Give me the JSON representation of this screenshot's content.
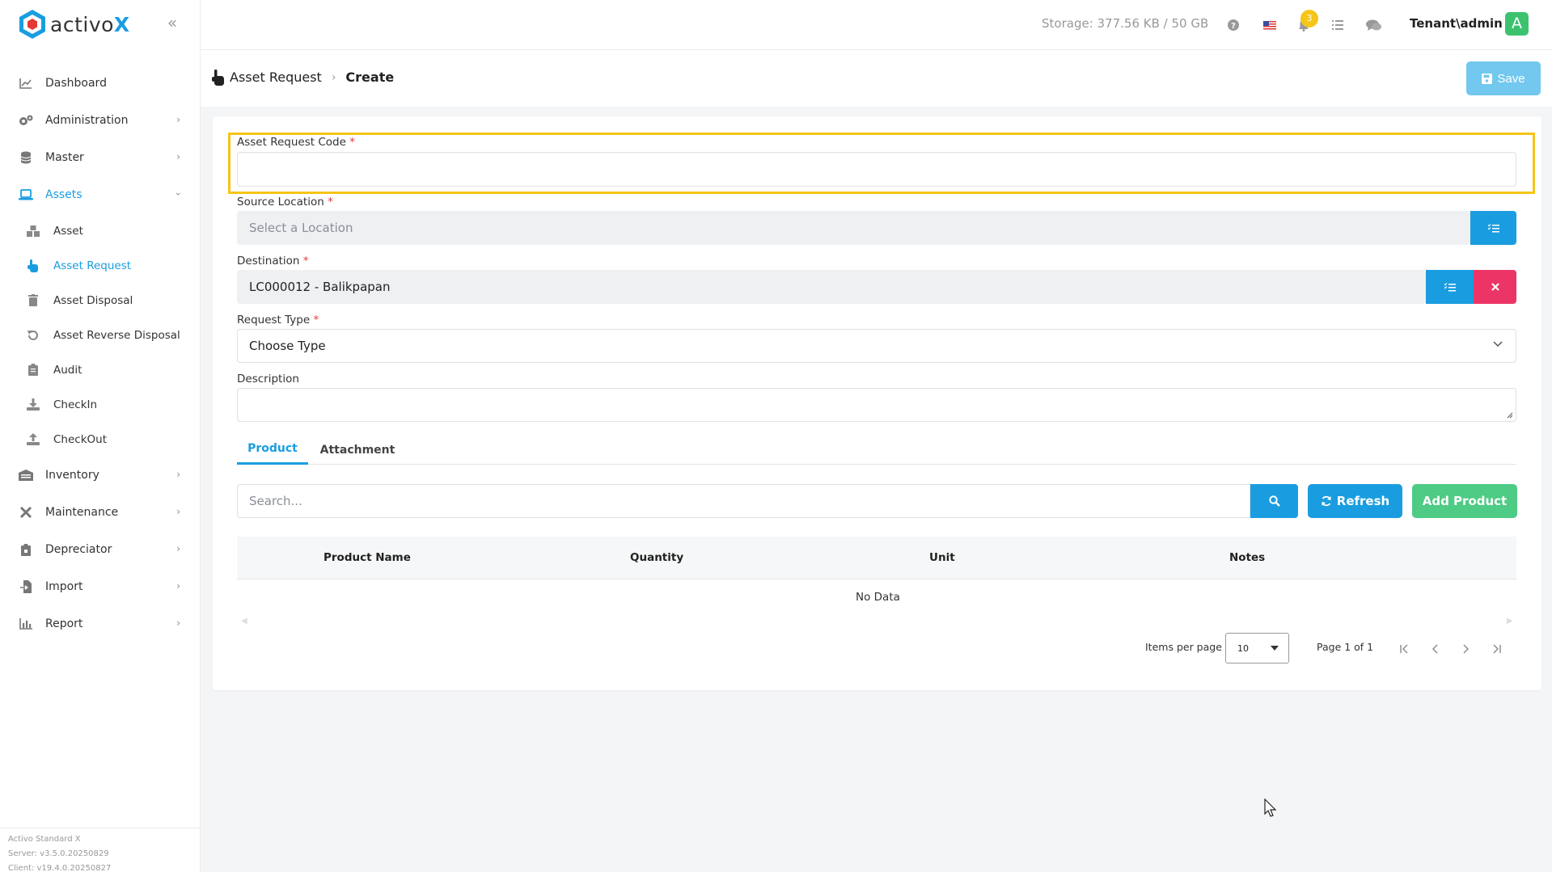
{
  "app": {
    "logo_text": "activo",
    "logo_accent": "X",
    "collapse_icon": "double-chevron-left-icon"
  },
  "sidebar": {
    "items": [
      {
        "label": "Dashboard",
        "icon": "chart-line-icon"
      },
      {
        "label": "Administration",
        "icon": "gears-icon"
      },
      {
        "label": "Master",
        "icon": "database-icon"
      },
      {
        "label": "Assets",
        "icon": "laptop-icon",
        "active": true
      },
      {
        "label": "Inventory",
        "icon": "warehouse-icon"
      },
      {
        "label": "Maintenance",
        "icon": "tools-icon"
      },
      {
        "label": "Depreciator",
        "icon": "clipboard-icon"
      },
      {
        "label": "Import",
        "icon": "file-import-icon"
      },
      {
        "label": "Report",
        "icon": "chart-bar-icon"
      }
    ],
    "asset_sub_items": [
      {
        "label": "Asset",
        "icon": "boxes-icon"
      },
      {
        "label": "Asset Request",
        "icon": "hand-pointer-icon",
        "active": true
      },
      {
        "label": "Asset Disposal",
        "icon": "trash-icon"
      },
      {
        "label": "Asset Reverse Disposal",
        "icon": "undo-icon"
      },
      {
        "label": "Audit",
        "icon": "clipboard-list-icon"
      },
      {
        "label": "CheckIn",
        "icon": "download-icon"
      },
      {
        "label": "CheckOut",
        "icon": "upload-icon"
      }
    ],
    "footer": {
      "product": "Activo Standard X",
      "server": "Server: v3.5.0.20250829",
      "client": "Client: v19.4.0.20250827"
    }
  },
  "topbar": {
    "storage": "Storage: 377.56 KB / 50 GB",
    "notification_count": "3",
    "user": "Tenant\\admin",
    "avatar_letter": "A"
  },
  "header": {
    "breadcrumb_parent": "Asset Request",
    "breadcrumb_current": "Create",
    "save_label": "Save"
  },
  "form": {
    "code_label": "Asset Request Code",
    "code_value": "",
    "source_label": "Source Location",
    "source_placeholder": "Select a Location",
    "destination_label": "Destination",
    "destination_value": "LC000012 - Balikpapan",
    "request_type_label": "Request Type",
    "request_type_value": "Choose Type",
    "description_label": "Description",
    "required_mark": "*"
  },
  "tabs": [
    {
      "label": "Product",
      "active": true
    },
    {
      "label": "Attachment",
      "active": false
    }
  ],
  "product": {
    "search_placeholder": "Search...",
    "refresh_label": "Refresh",
    "add_label": "Add Product",
    "columns": [
      "Product Name",
      "Quantity",
      "Unit",
      "Notes"
    ],
    "empty_text": "No Data",
    "items_per_page_label": "Items per page",
    "items_per_page_value": "10",
    "page_label": "Page 1 of 1"
  },
  "colors": {
    "accent": "#1a9de0",
    "danger": "#ec3566",
    "success": "#4ecb84",
    "highlight": "#f5c518",
    "save_disabled": "#72c8ee"
  }
}
